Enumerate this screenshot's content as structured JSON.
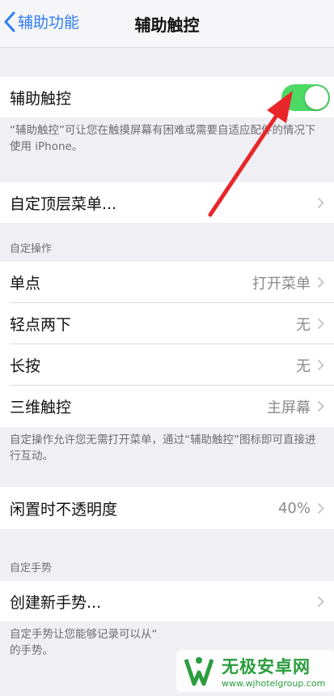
{
  "nav": {
    "back_label": "辅助功能",
    "title": "辅助触控"
  },
  "main_toggle": {
    "label": "辅助触控",
    "on": true,
    "footnote": "“辅助触控”可让您在触摸屏幕有困难或需要自适应配件的情况下使用 iPhone。"
  },
  "top_menu": {
    "label": "自定顶层菜单..."
  },
  "custom_actions": {
    "header": "自定操作",
    "rows": [
      {
        "label": "单点",
        "value": "打开菜单"
      },
      {
        "label": "轻点两下",
        "value": "无"
      },
      {
        "label": "长按",
        "value": "无"
      },
      {
        "label": "三维触控",
        "value": "主屏幕"
      }
    ],
    "footnote": "自定操作允许您无需打开菜单，通过“辅助触控”图标即可直接进行互动。"
  },
  "opacity": {
    "label": "闲置时不透明度",
    "value": "40%"
  },
  "custom_gestures": {
    "header": "自定手势",
    "create_label": "创建新手势...",
    "footnote": "自定手势让您能够记录可以从“"
  },
  "footnote_tail": "的手势。",
  "watermark": {
    "title": "无极安卓网",
    "url": "www.wjhotelgroup.com"
  },
  "colors": {
    "accent": "#2f7cf6",
    "toggle_on": "#4cd964",
    "annotation": "#e8262a"
  }
}
